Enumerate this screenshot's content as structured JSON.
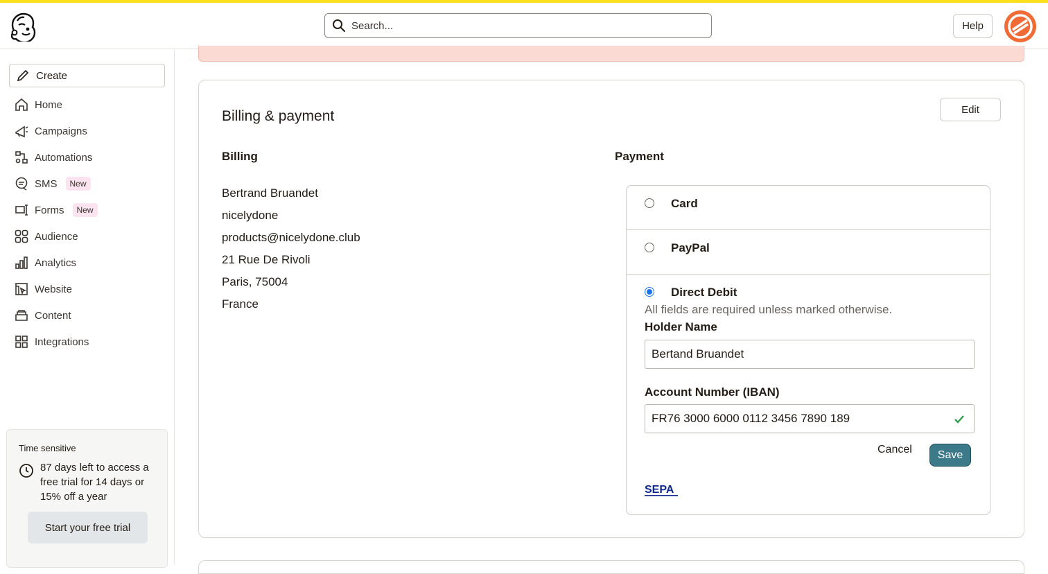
{
  "search": {
    "placeholder": "Search..."
  },
  "header": {
    "help_label": "Help"
  },
  "sidebar": {
    "create_label": "Create",
    "items": [
      {
        "label": "Home",
        "icon": "home-icon"
      },
      {
        "label": "Campaigns",
        "icon": "megaphone-icon"
      },
      {
        "label": "Automations",
        "icon": "flow-icon"
      },
      {
        "label": "SMS",
        "icon": "chat-icon",
        "badge": "New"
      },
      {
        "label": "Forms",
        "icon": "form-icon",
        "badge": "New"
      },
      {
        "label": "Audience",
        "icon": "audience-icon"
      },
      {
        "label": "Analytics",
        "icon": "bar-chart-icon"
      },
      {
        "label": "Website",
        "icon": "website-icon"
      },
      {
        "label": "Content",
        "icon": "content-icon"
      },
      {
        "label": "Integrations",
        "icon": "grid-icon"
      }
    ]
  },
  "promo": {
    "title": "Time sensitive",
    "text": "87 days left to access a free trial for 14 days or 15% off a year",
    "button_label": "Start your free trial"
  },
  "billing_card": {
    "title": "Billing & payment",
    "edit_label": "Edit",
    "billing_heading": "Billing",
    "payment_heading": "Payment",
    "billing_lines": [
      "Bertrand Bruandet",
      "nicelydone",
      "products@nicelydone.club",
      "21 Rue De Rivoli",
      "Paris, 75004",
      "France"
    ],
    "payment_options": [
      {
        "label": "Card",
        "selected": false
      },
      {
        "label": "PayPal",
        "selected": false
      },
      {
        "label": "Direct Debit",
        "selected": true
      }
    ],
    "required_hint": "All fields are required unless marked otherwise.",
    "holder_label": "Holder Name",
    "holder_value": "Bertand Bruandet",
    "iban_label": "Account Number (IBAN)",
    "iban_value": "FR76 3000 6000 0112 3456 7890 189",
    "cancel_label": "Cancel",
    "save_label": "Save",
    "sepa_logo": "SEPA"
  },
  "colors": {
    "top_stripe": "#ffe01b",
    "avatar": "#f06b35",
    "save_button": "#3c7a89",
    "alert_bg": "#fadad2",
    "new_badge_bg": "#fbe4ef",
    "radio_selected": "#1a73e8",
    "valid_check": "#2e9e4f"
  }
}
